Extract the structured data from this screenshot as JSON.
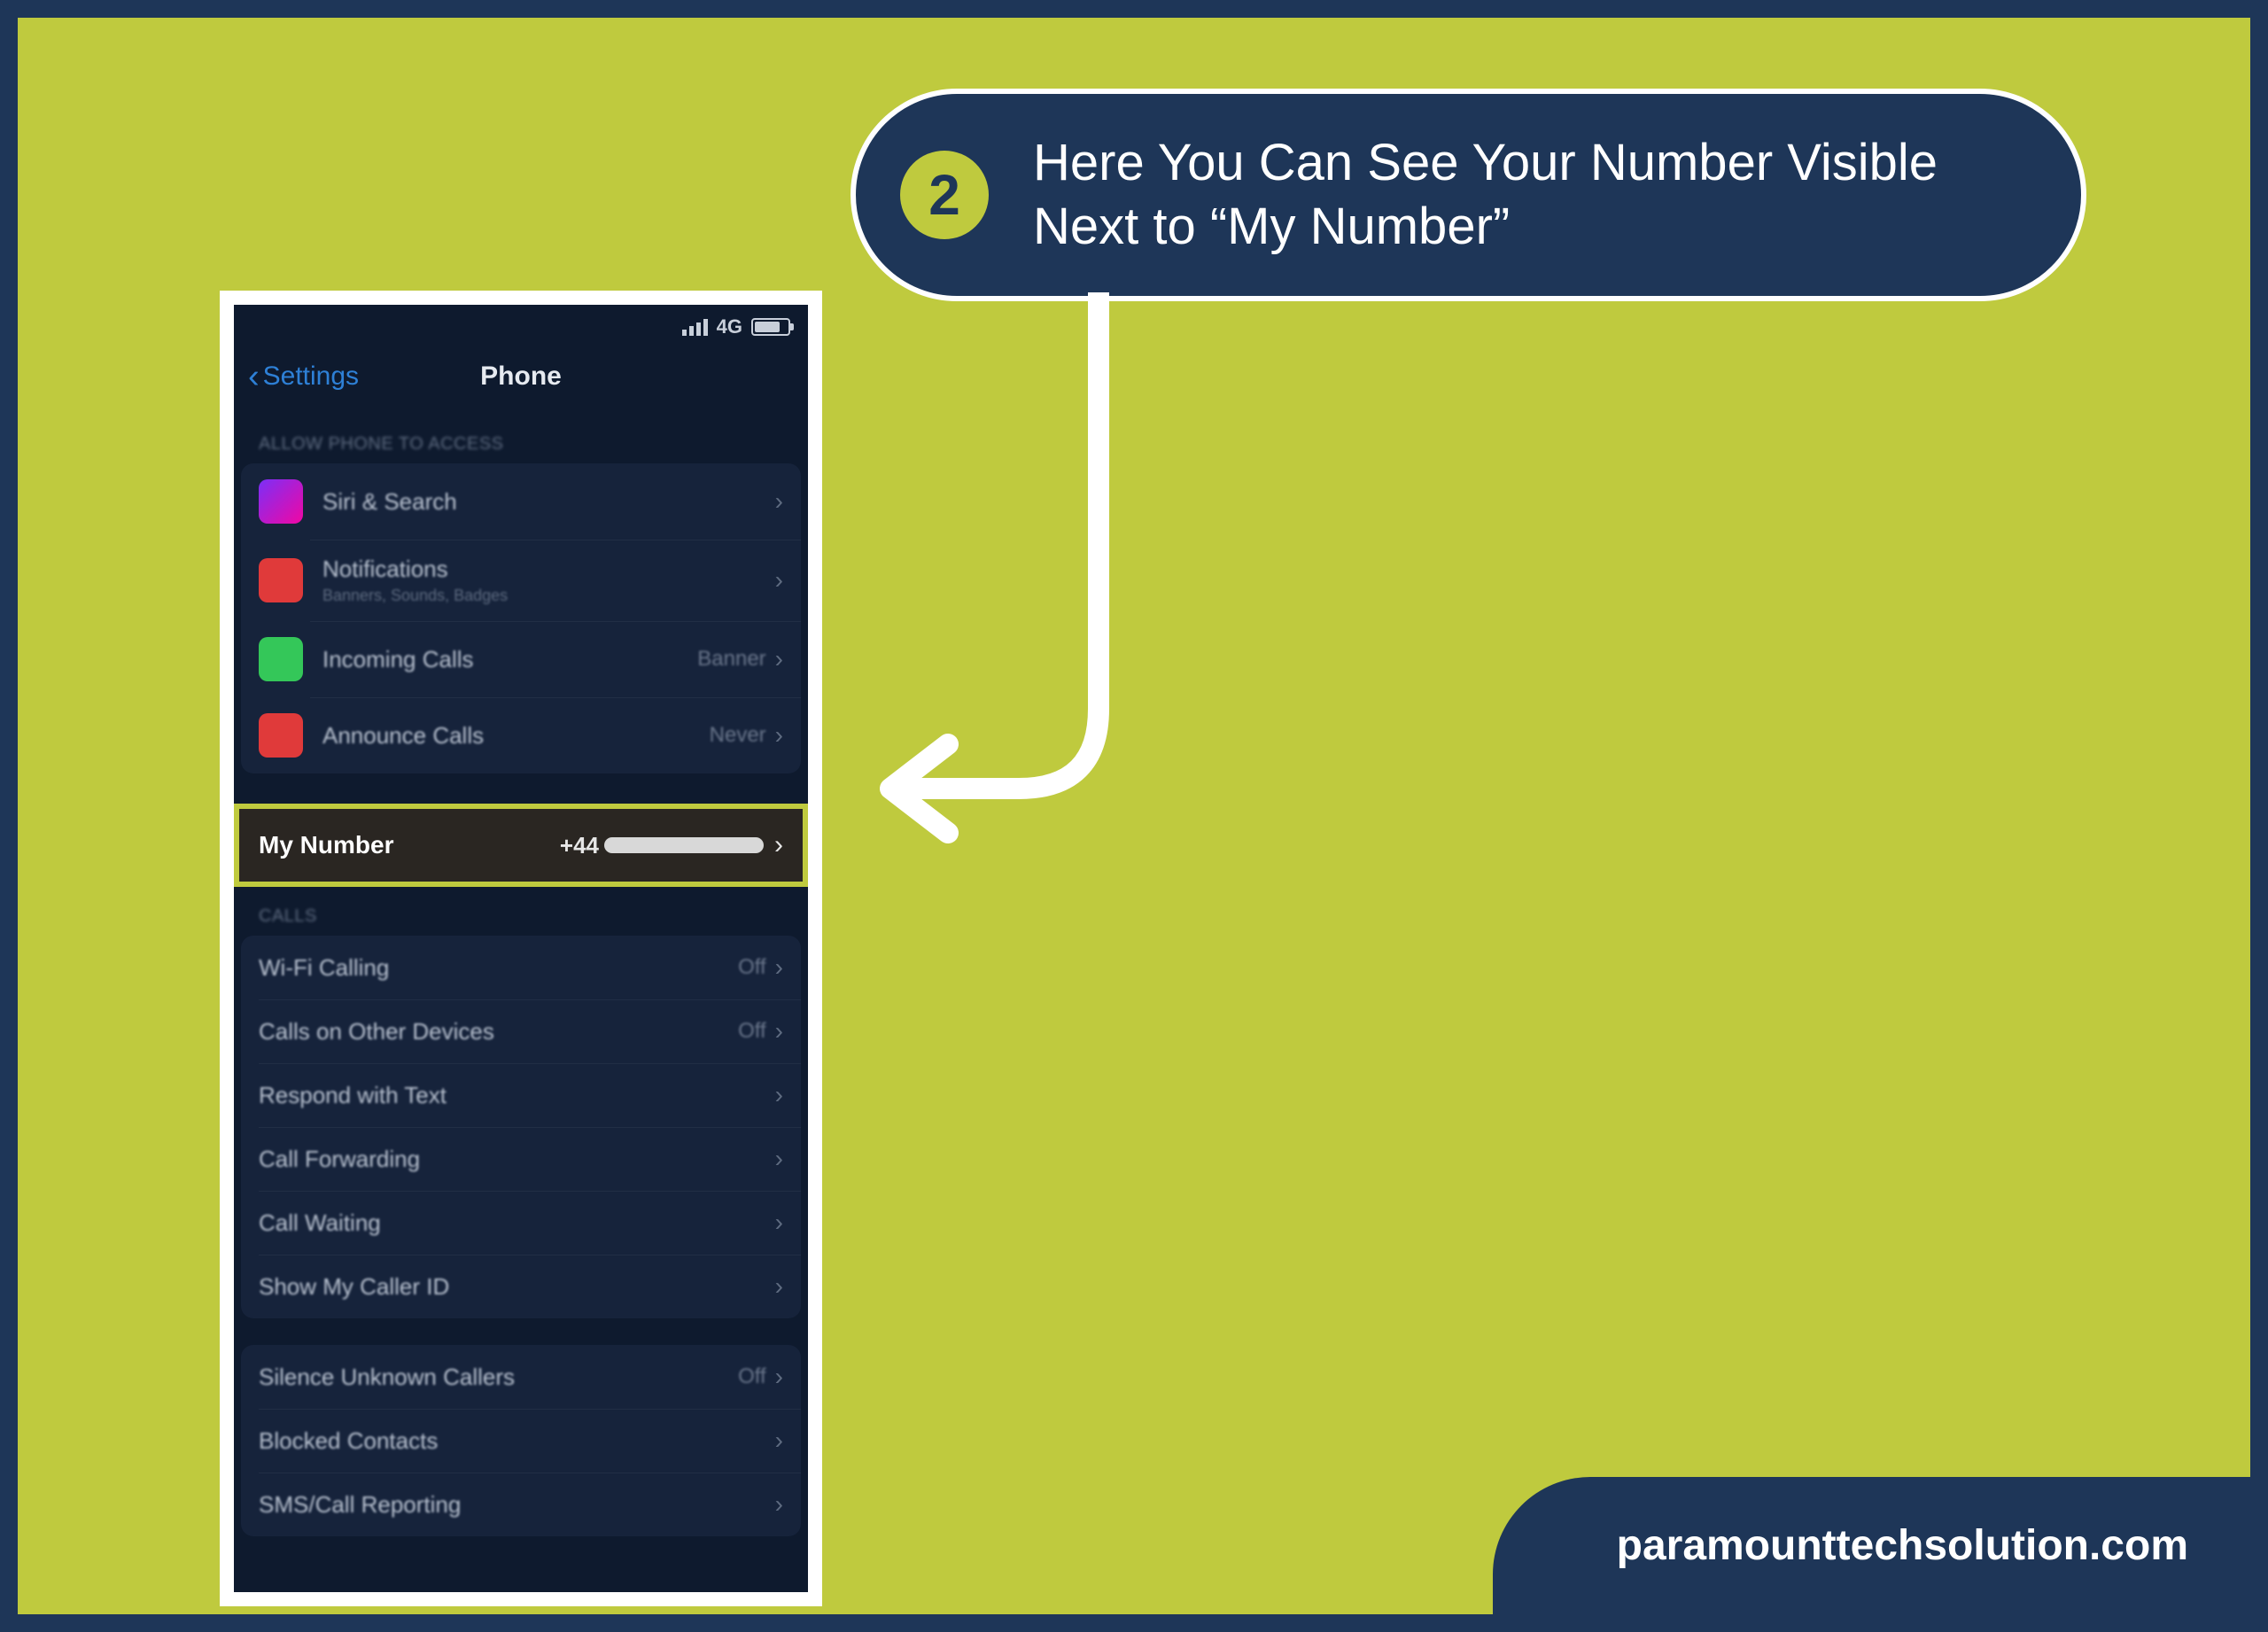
{
  "callout": {
    "step": "2",
    "text": "Here You Can See Your Number Visible Next to “My Number”"
  },
  "footer": "paramounttechsolution.com",
  "phone": {
    "status": {
      "network": "4G"
    },
    "back_label": "Settings",
    "title": "Phone",
    "section_access": "ALLOW PHONE TO ACCESS",
    "rows_access": [
      {
        "icon_bg": "linear-gradient(135deg,#7b2ff7,#f107a3)",
        "label": "Siri & Search"
      },
      {
        "icon_bg": "#e03a3a",
        "label": "Notifications",
        "sub": "Banners, Sounds, Badges"
      },
      {
        "icon_bg": "#34c759",
        "label": "Incoming Calls",
        "value": "Banner"
      },
      {
        "icon_bg": "#e03a3a",
        "label": "Announce Calls",
        "value": "Never"
      }
    ],
    "my_number": {
      "label": "My Number",
      "prefix": "+44"
    },
    "section_calls": "CALLS",
    "rows_calls": [
      {
        "label": "Wi-Fi Calling",
        "value": "Off"
      },
      {
        "label": "Calls on Other Devices",
        "value": "Off"
      },
      {
        "label": "Respond with Text"
      },
      {
        "label": "Call Forwarding"
      },
      {
        "label": "Call Waiting"
      },
      {
        "label": "Show My Caller ID"
      }
    ],
    "rows_other": [
      {
        "label": "Silence Unknown Callers",
        "value": "Off"
      },
      {
        "label": "Blocked Contacts"
      },
      {
        "label": "SMS/Call Reporting"
      }
    ]
  }
}
